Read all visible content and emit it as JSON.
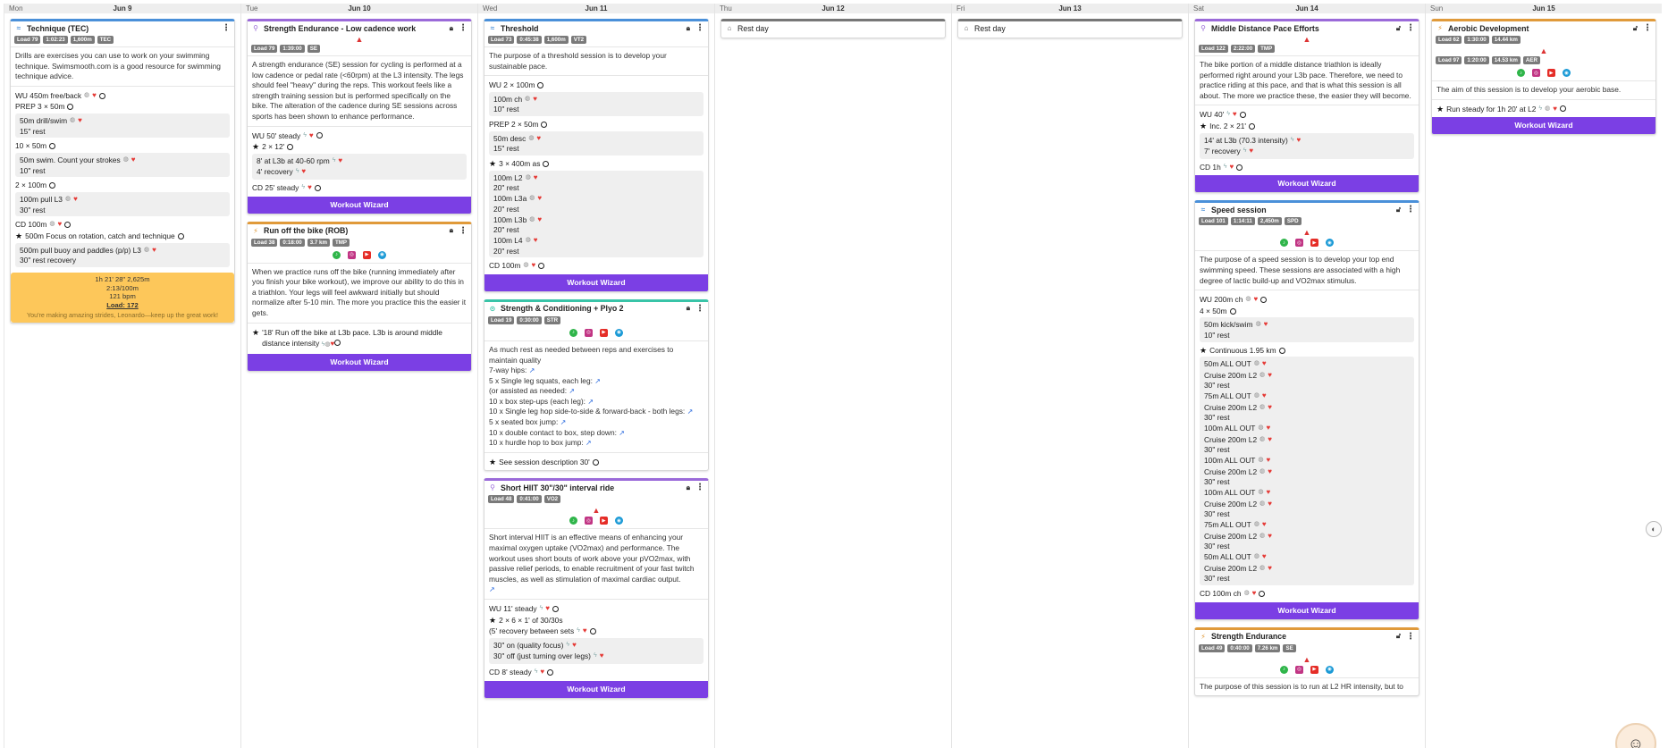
{
  "colors": {
    "swim": "#4a90d9",
    "bike": "#9b6ad9",
    "run": "#e09a3a",
    "strength": "#39c4a8",
    "wizard": "#7b3fe4",
    "summary": "#fdc75a",
    "warning": "#d33333"
  },
  "wizard_label": "Workout Wizard",
  "days": [
    {
      "dn": "Mon",
      "dd": "Jun 9"
    },
    {
      "dn": "Tue",
      "dd": "Jun 10"
    },
    {
      "dn": "Wed",
      "dd": "Jun 11"
    },
    {
      "dn": "Thu",
      "dd": "Jun 12"
    },
    {
      "dn": "Fri",
      "dd": "Jun 13"
    },
    {
      "dn": "Sat",
      "dd": "Jun 14"
    },
    {
      "dn": "Sun",
      "dd": "Jun 15"
    }
  ],
  "mon": {
    "tec": {
      "title": "Technique (TEC)",
      "badges": [
        "Load 79",
        "1:02:23",
        "1,600m",
        "TEC"
      ],
      "desc": "Drills are exercises you can use to work on your swimming technique. Swimsmooth.com is a good resource for swimming technique advice.",
      "s1": "WU 450m free/back",
      "s2": "PREP 3 × 50m",
      "s2a": "50m drill/swim",
      "s2b": "15\" rest",
      "s3": "10 × 50m",
      "s3a": "50m swim. Count your strokes",
      "s3b": "10\" rest",
      "s4": "2 × 100m",
      "s4a": "100m pull L3",
      "s4b": "30\" rest",
      "s5": "CD 100m",
      "s6": "500m Focus on rotation, catch and technique",
      "s6a": "500m pull buoy and paddles (p/p) L3",
      "s6b": "30\" rest recovery"
    },
    "summary": {
      "l1": "1h 21' 28\"   2,625m",
      "l2": "2:13/100m",
      "l3": "121 bpm",
      "l4": "Load: 172",
      "enc": "You're making amazing strides, Leonardo—keep up the great work!"
    }
  },
  "tue": {
    "se": {
      "title": "Strength Endurance - Low cadence work",
      "badges": [
        "Load 79",
        "1:39:00",
        "SE"
      ],
      "desc": "A strength endurance (SE) session for cycling is performed at a low cadence or pedal rate (<60rpm) at the L3 intensity. The legs should feel \"heavy\" during the reps. This workout feels like a strength training session but is performed specifically on the bike. The alteration of the cadence during SE sessions across sports has been shown to enhance performance.",
      "s1": "WU 50' steady",
      "s2": "2 × 12'",
      "s2a": "8' at L3b at 40-60 rpm",
      "s2b": "4' recovery",
      "s3": "CD 25' steady"
    },
    "rob": {
      "title": "Run off the bike (ROB)",
      "badges": [
        "Load 38",
        "0:18:00",
        "3.7 km",
        "TMP"
      ],
      "desc": "When we practice runs off the bike (running immediately after you finish your bike workout), we improve our ability to do this in a triathlon. Your legs will feel awkward initially but should normalize after 5-10 min. The more you practice this the easier it gets.",
      "s1": "'18' Run off the bike at L3b pace. L3b is around middle distance intensity"
    }
  },
  "wed": {
    "thr": {
      "title": "Threshold",
      "badges": [
        "Load 73",
        "0:45:38",
        "1,600m",
        "VT2"
      ],
      "desc": "The purpose of a threshold session is to develop your sustainable pace.",
      "s1": "WU 2 × 100m",
      "s1a": "100m ch",
      "s1b": "10\" rest",
      "s2": "PREP 2 × 50m",
      "s2a": "50m desc",
      "s2b": "15\" rest",
      "s3": "3 × 400m as",
      "s3a": "100m L2",
      "s3b": "20\" rest",
      "s3c": "100m L3a",
      "s3d": "20\" rest",
      "s3e": "100m L3b",
      "s3f": "20\" rest",
      "s3g": "100m L4",
      "s3h": "20\" rest",
      "s4": "CD 100m"
    },
    "sc": {
      "title": "Strength & Conditioning + Plyo 2",
      "badges": [
        "Load 19",
        "0:30:00",
        "STR"
      ],
      "desc": "As much rest as needed between reps and exercises to maintain quality",
      "items": [
        "7-way hips:",
        "5 x Single leg squats, each leg:",
        "(or assisted as needed:",
        "10 x box step-ups (each leg):",
        "10 x Single leg hop side-to-side & forward-back - both legs:",
        "5 x seated box jump:",
        "10 x double contact to box, step down:",
        "10 x hurdle hop to box jump:"
      ],
      "s1": "See session description 30'"
    },
    "hiit": {
      "title": "Short HIIT 30\"/30\" interval ride",
      "badges": [
        "Load 48",
        "0:41:00",
        "VO2"
      ],
      "desc": "Short interval HIIT is an effective means of enhancing your maximal oxygen uptake (VO2max) and performance. The workout uses short bouts of work above your pVO2max, with passive relief periods, to enable recruitment of your fast twitch muscles, as well as stimulation of maximal cardiac output.",
      "s1": "WU 11' steady",
      "s2": "2 × 6 × 1' of 30/30s",
      "s3": "(5' recovery between sets",
      "s3a": "30\" on (quality focus)",
      "s3b": "30\" off (just turning over legs)",
      "s4": "CD 8' steady"
    }
  },
  "thu": {
    "rest": "Rest day"
  },
  "fri": {
    "rest": "Rest day"
  },
  "sat": {
    "md": {
      "title": "Middle Distance Pace Efforts",
      "badges": [
        "Load 122",
        "2:22:00",
        "TMP"
      ],
      "desc": "The bike portion of a middle distance triathlon is ideally performed right around your L3b pace. Therefore, we need to practice riding at this pace, and that is what this session is all about. The more we practice these, the easier they will become.",
      "s1": "WU 40'",
      "s2": "Inc. 2 × 21'",
      "s2a": "14' at L3b (70.3 intensity)",
      "s2b": "7' recovery",
      "s3": "CD 1h"
    },
    "speed": {
      "title": "Speed session",
      "badges": [
        "Load 101",
        "1:14:11",
        "2,450m",
        "SPD"
      ],
      "desc": "The purpose of a speed session is to develop your top end swimming speed. These sessions are associated with a high degree of lactic build-up and VO2max stimulus.",
      "s1": "WU 200m ch",
      "s2": "4 × 50m",
      "s2a": "50m kick/swim",
      "s2b": "10\" rest",
      "s3": "Continuous 1.95 km",
      "cont": [
        "50m ALL OUT",
        "Cruise 200m L2",
        "30\" rest",
        "75m ALL OUT",
        "Cruise 200m L2",
        "30\" rest",
        "100m ALL OUT",
        "Cruise 200m L2",
        "30\" rest",
        "100m ALL OUT",
        "Cruise 200m L2",
        "30\" rest",
        "100m ALL OUT",
        "Cruise 200m L2",
        "30\" rest",
        "75m ALL OUT",
        "Cruise 200m L2",
        "30\" rest",
        "50m ALL OUT",
        "Cruise 200m L2",
        "30\" rest"
      ],
      "s4": "CD 100m ch"
    },
    "se2": {
      "title": "Strength Endurance",
      "badges": [
        "Load 49",
        "0:40:00",
        "7.26 km",
        "SE"
      ],
      "desc": "The purpose of this session is to run at L2 HR intensity, but to"
    }
  },
  "sun": {
    "aer": {
      "title": "Aerobic Development",
      "badges_top": [
        "Load 62",
        "1:30:00",
        "14.44 km"
      ],
      "badges": [
        "Load 97",
        "1:20:00",
        "14.53 km",
        "AER"
      ],
      "desc": "The aim of this session is to develop your aerobic base.",
      "s1": "Run steady for 1h 20' at L2"
    }
  },
  "icons": {
    "lock": "lock-icon",
    "unlock": "unlock-icon",
    "menu": "kebab-menu-icon",
    "swim": "swim-icon",
    "bike": "bike-icon",
    "run": "run-icon",
    "strength": "strength-icon",
    "rest": "bed-icon"
  }
}
